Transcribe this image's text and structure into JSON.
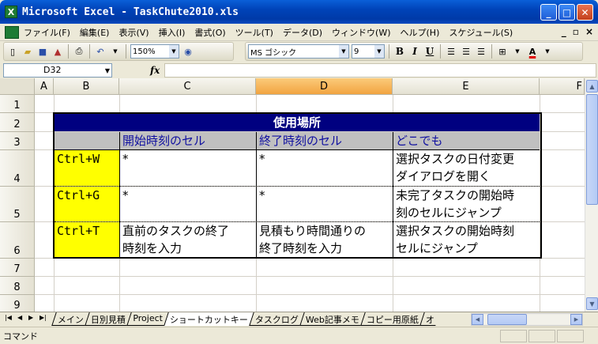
{
  "window": {
    "title": "Microsoft Excel - TaskChute2010.xls",
    "app_icon": "X"
  },
  "menu": {
    "items": [
      "ファイル(F)",
      "編集(E)",
      "表示(V)",
      "挿入(I)",
      "書式(O)",
      "ツール(T)",
      "データ(D)",
      "ウィンドウ(W)",
      "ヘルプ(H)",
      "スケジュール(S)"
    ],
    "min_glyph": "_",
    "restore_glyph": "▫",
    "close_glyph": "×"
  },
  "toolbar": {
    "zoom": "150%",
    "font_name": "MS ゴシック",
    "font_size": "9",
    "bold": "B",
    "italic": "I",
    "underline": "U",
    "font_color": "A"
  },
  "formula_bar": {
    "cell_ref": "D32",
    "fx": "fx",
    "value": ""
  },
  "grid": {
    "columns": [
      "A",
      "B",
      "C",
      "D",
      "E",
      "F"
    ],
    "selected_column": "D",
    "rows": [
      "1",
      "2",
      "3",
      "4",
      "5",
      "6",
      "7",
      "8",
      "9"
    ]
  },
  "table": {
    "header": "使用場所",
    "subheaders": [
      "開始時刻のセル",
      "終了時刻のセル",
      "どこでも"
    ],
    "rows": [
      {
        "key": "Ctrl+W",
        "start": "*",
        "end": "*",
        "anywhere_1": "選択タスクの日付変更",
        "anywhere_2": "ダイアログを開く"
      },
      {
        "key": "Ctrl+G",
        "start": "*",
        "end": "*",
        "anywhere_1": "未完了タスクの開始時",
        "anywhere_2": "刻のセルにジャンプ"
      },
      {
        "key": "Ctrl+T",
        "start_1": "直前のタスクの終了",
        "start_2": "時刻を入力",
        "end_1": "見積もり時間通りの",
        "end_2": "終了時刻を入力",
        "anywhere_1": "選択タスクの開始時刻",
        "anywhere_2": "セルにジャンプ"
      }
    ],
    "colors": {
      "header_bg": "#000080",
      "subheader_bg": "#C0C0C0",
      "key_bg": "#FFFF00"
    }
  },
  "sheet_tabs": [
    "メイン",
    "日別見積",
    "Project",
    "ショートカットキー",
    "タスクログ",
    "Web記事メモ",
    "コピー用原紙",
    "オ"
  ],
  "active_sheet": "ショートカットキー",
  "status": {
    "mode": "コマンド"
  }
}
